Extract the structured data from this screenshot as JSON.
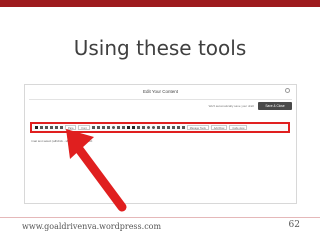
{
  "slide": {
    "title": "Using these tools",
    "footer_url": "www.goaldrivenva.wordpress.com",
    "page_number": "62",
    "accent_color": "#9e1b1e"
  },
  "dialog": {
    "title": "Edit Your Content",
    "draft_status": "We'll automatically save your draft",
    "save_close_label": "Save & Close",
    "help_icon": "help-circle-icon"
  },
  "toolbar": {
    "border_color": "#e01f1f",
    "icons_left": [
      "bold-icon",
      "italic-icon",
      "underline-icon",
      "strikethrough-icon",
      "align-left-icon",
      "align-center-icon",
      "align-right-icon"
    ],
    "paragraph_select": "Para",
    "font_select": "Font",
    "icons_right": [
      "bullet-list-icon",
      "numbered-list-icon",
      "outdent-icon",
      "indent-icon",
      "quote-icon",
      "link-icon",
      "unlink-icon",
      "anchor-icon",
      "image-icon",
      "table-icon",
      "media-icon",
      "hr-icon",
      "special-char-icon",
      "emoticon-icon",
      "undo-icon",
      "redo-icon",
      "text-color-icon",
      "bg-color-icon",
      "clear-format-icon",
      "fullscreen-icon"
    ],
    "manage_select": "Manage Tools",
    "layout_select": "Add Row",
    "view_select": "Code view"
  },
  "editor": {
    "text": "rmat text select (all/click - shift for list) add text"
  },
  "arrow": {
    "color": "#e01f1f"
  }
}
